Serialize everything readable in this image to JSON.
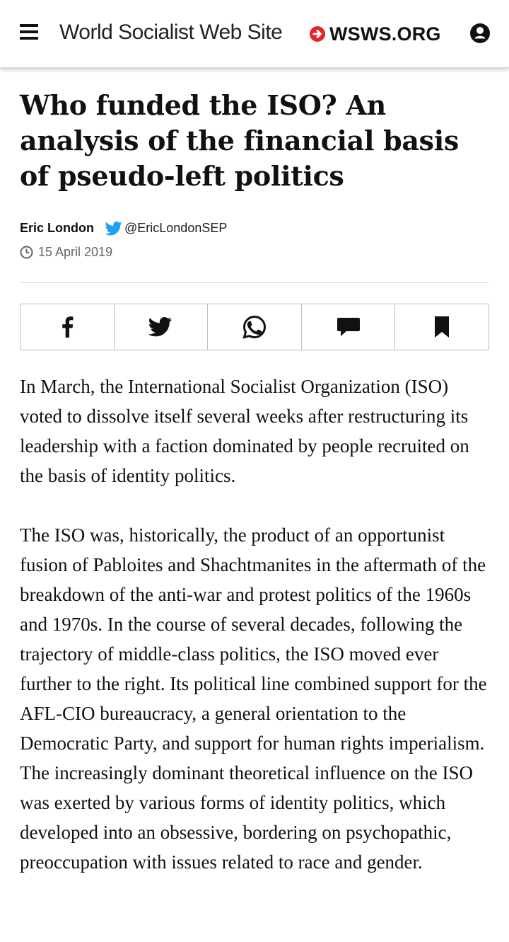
{
  "header": {
    "site_name": "World Socialist Web Site",
    "logo_text": "WSWS.ORG",
    "menu_icon": "hamburger-menu-icon",
    "user_icon": "user-account-icon",
    "colors": {
      "logo_accent": "#e8232a"
    }
  },
  "article": {
    "title": "Who funded the ISO? An analysis of the financial basis of pseudo-left politics",
    "author": "Eric London",
    "twitter_handle": "@EricLondonSEP",
    "date": "15 April 2019",
    "paragraphs": [
      "In March, the International Socialist Organization (ISO) voted to dissolve itself several weeks after restructuring its leadership with a faction dominated by people recruited on the basis of identity politics.",
      "The ISO was, historically, the product of an opportunist fusion of Pabloites and Shachtmanites in the aftermath of the breakdown of the anti-war and protest politics of the 1960s and 1970s. In the course of several decades, following the trajectory of middle-class politics, the ISO moved ever further to the right. Its political line combined support for the AFL-CIO bureaucracy, a general orientation to the Democratic Party, and support for human rights imperialism. The increasingly dominant theoretical influence on the ISO was exerted by various forms of identity politics, which developed into an obsessive, bordering on psychopathic, preoccupation with issues related to race and gender."
    ]
  },
  "share_bar": {
    "buttons": [
      "facebook-icon",
      "twitter-icon",
      "whatsapp-icon",
      "comment-icon",
      "bookmark-icon"
    ]
  },
  "colors": {
    "twitter_blue": "#1da1f2",
    "text": "#111111",
    "muted": "#666666"
  }
}
